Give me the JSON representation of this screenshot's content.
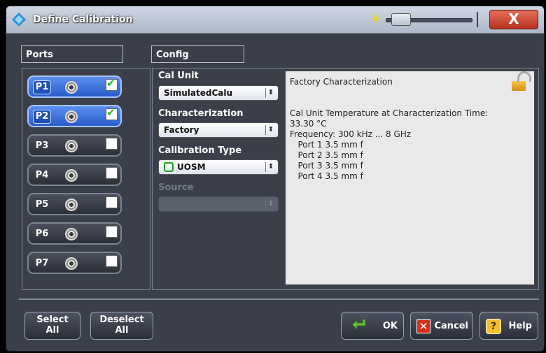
{
  "window": {
    "title": "Define Calibration",
    "close_label": "X",
    "brightness_icon": "sun-icon"
  },
  "ports": {
    "header": "Ports",
    "items": [
      {
        "label": "P1",
        "checked": true
      },
      {
        "label": "P2",
        "checked": true
      },
      {
        "label": "P3",
        "checked": false
      },
      {
        "label": "P4",
        "checked": false
      },
      {
        "label": "P5",
        "checked": false
      },
      {
        "label": "P6",
        "checked": false
      },
      {
        "label": "P7",
        "checked": false
      }
    ]
  },
  "config": {
    "header": "Config",
    "cal_unit_label": "Cal Unit",
    "cal_unit_value": "SimulatedCalu",
    "characterization_label": "Characterization",
    "characterization_value": "Factory",
    "cal_type_label": "Calibration Type",
    "cal_type_value": "UOSM",
    "source_label": "Source",
    "source_value": ""
  },
  "info": {
    "title": "Factory Characterization",
    "lines": [
      "Cal Unit Temperature at Characterization Time:",
      "33.30 °C",
      "Frequency: 300 kHz ... 8 GHz",
      "   Port 1 3.5 mm f",
      "   Port 2 3.5 mm f",
      "   Port 3 3.5 mm f",
      "   Port 4 3.5 mm f"
    ]
  },
  "buttons": {
    "select_all_l1": "Select",
    "select_all_l2": "All",
    "deselect_all_l1": "Deselect",
    "deselect_all_l2": "All",
    "ok": "OK",
    "cancel": "Cancel",
    "help": "Help"
  },
  "colors": {
    "selected_port": "#3a6fd8",
    "dialog_bg": "#3a3f4a",
    "info_bg": "#e9e9e9"
  }
}
